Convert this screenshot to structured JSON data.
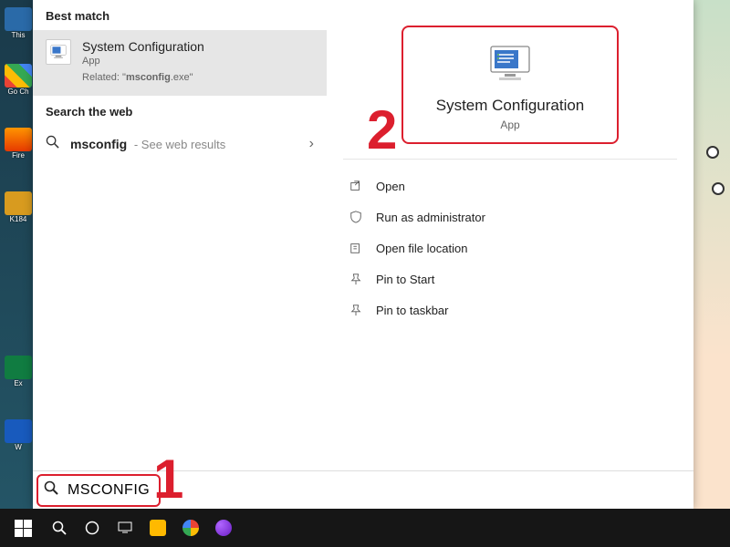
{
  "desktop": {
    "icons": [
      {
        "label": "This"
      },
      {
        "label": "Go Ch"
      },
      {
        "label": "Fire"
      },
      {
        "label": "K184"
      },
      {
        "label": "Ex"
      },
      {
        "label": "W"
      }
    ]
  },
  "search": {
    "best_match_header": "Best match",
    "best_match": {
      "title": "System Configuration",
      "type": "App",
      "related_prefix": "Related: \"",
      "related_term": "msconfig",
      "related_suffix": ".exe\""
    },
    "web_header": "Search the web",
    "web_query": "msconfig",
    "web_hint": " - See web results",
    "input_value": "MSCONFIG"
  },
  "preview": {
    "title": "System Configuration",
    "type": "App",
    "actions": [
      {
        "label": "Open",
        "icon": "open"
      },
      {
        "label": "Run as administrator",
        "icon": "admin"
      },
      {
        "label": "Open file location",
        "icon": "folder"
      },
      {
        "label": "Pin to Start",
        "icon": "pin"
      },
      {
        "label": "Pin to taskbar",
        "icon": "pin"
      }
    ]
  },
  "annotations": {
    "step1": "1",
    "step2": "2"
  },
  "colors": {
    "highlight": "#dc1f2e"
  }
}
